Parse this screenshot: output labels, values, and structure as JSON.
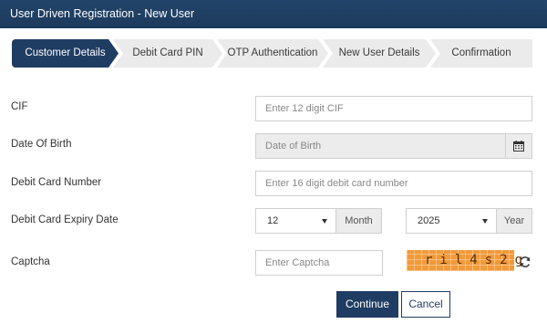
{
  "header": {
    "title": "User Driven Registration - New User"
  },
  "wizard": {
    "steps": [
      {
        "label": "Customer Details"
      },
      {
        "label": "Debit Card PIN"
      },
      {
        "label": "OTP Authentication"
      },
      {
        "label": "New User Details"
      },
      {
        "label": "Confirmation"
      }
    ],
    "active_index": 0
  },
  "form": {
    "cif": {
      "label": "CIF",
      "placeholder": "Enter 12 digit CIF"
    },
    "dob": {
      "label": "Date Of Birth",
      "placeholder": "Date of Birth",
      "icon": "calendar-icon"
    },
    "card_number": {
      "label": "Debit Card Number",
      "placeholder": "Enter 16 digit debit card number"
    },
    "expiry": {
      "label": "Debit Card Expiry Date",
      "month_value": "12",
      "month_addon": "Month",
      "year_value": "2025",
      "year_addon": "Year"
    },
    "captcha": {
      "label": "Captcha",
      "placeholder": "Enter Captcha",
      "code": "ril4s2g",
      "refresh_icon": "refresh-icon"
    }
  },
  "actions": {
    "continue_label": "Continue",
    "cancel_label": "Cancel"
  },
  "colors": {
    "brand": "#1f3d63",
    "captcha_bg": "#f29a3a"
  }
}
